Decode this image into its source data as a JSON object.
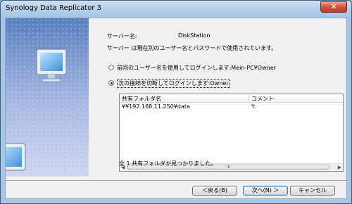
{
  "window": {
    "title": "Synology Data Replicator 3",
    "close_glyph": "✕"
  },
  "server": {
    "label": "サーバー名:",
    "name": "DiskStation",
    "notice": "サーバー は現在別のユーザー名とパスワードで使用されています。"
  },
  "options": [
    {
      "label": "前回のユーザー名を使用してログインします:Mein-PC¥Owner",
      "selected": false
    },
    {
      "label": "次の接続を切断してログインします:Owner",
      "selected": true
    }
  ],
  "table": {
    "columns": [
      "共有フォルダ名",
      "コメント"
    ],
    "rows": [
      {
        "folder": "¥¥192.168.11.250¥data",
        "comment": "Y:"
      }
    ],
    "scroll_left": "◀",
    "scroll_right": "▶",
    "scroll_grip": "III"
  },
  "status": "全 1 共有フォルダが見つかりました。",
  "buttons": {
    "back": "＜戻る(B)",
    "next": "次へ(N) ＞",
    "cancel": "キャンセル"
  },
  "colors": {
    "side_top": "#5a80c0",
    "side_bottom": "#cdd6ef",
    "close": "#c0392b"
  }
}
